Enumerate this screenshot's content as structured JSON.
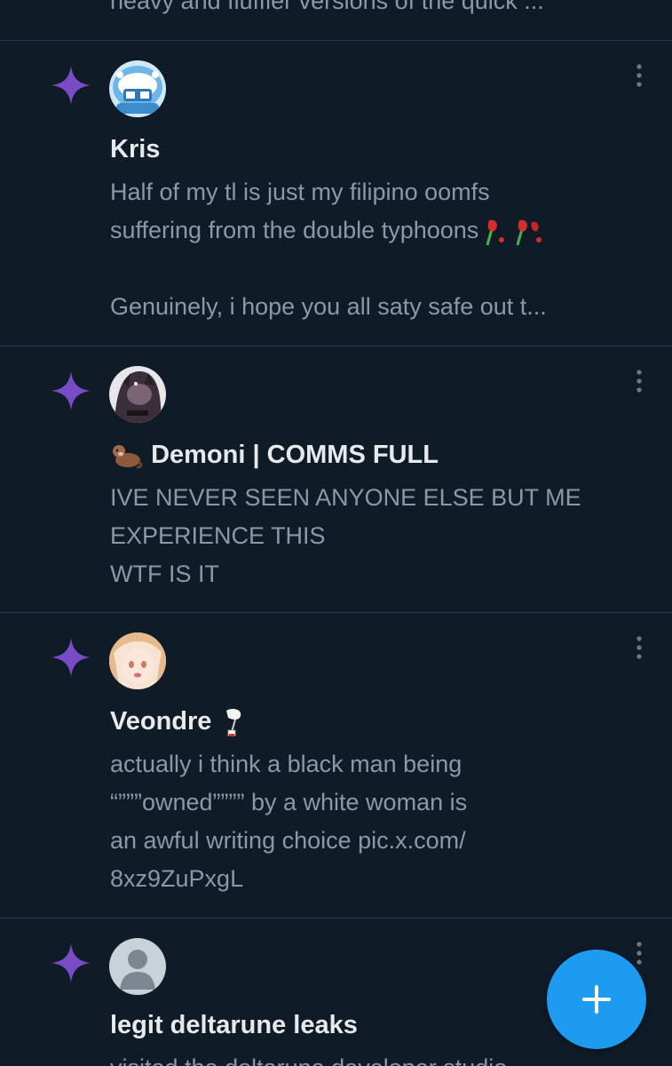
{
  "colors": {
    "background": "#0f1c28",
    "divider": "#2a3744",
    "sparkle": "#794bc4",
    "name_text": "#e7e9ea",
    "body_text": "#8b98a5",
    "fab": "#1d9bf0"
  },
  "prev_post": {
    "text_tail": "heavy and fluffier versions of the quick ..."
  },
  "posts": [
    {
      "name": "Kris",
      "lines": [
        "Half of my tl is just my filipino oomfs",
        "suffering from the double typhoons",
        "",
        "Genuinely, i hope you all saty safe out t..."
      ],
      "emoji": "wilted-flower-emoji x2"
    },
    {
      "name_prefix_emoji": "otter-emoji",
      "name": "Demoni | COMMS FULL",
      "lines": [
        "IVE NEVER SEEN ANYONE ELSE BUT ME",
        "EXPERIENCE THIS",
        "WTF IS IT"
      ]
    },
    {
      "name": "Veondre",
      "name_suffix_emoji": "wind-chime-emoji",
      "lines": [
        "actually i think a black man being",
        "“”””owned”””” by a white woman is",
        "an awful writing choice pic.x.com/",
        "8xz9ZuPxgL"
      ]
    },
    {
      "name": "legit deltarune leaks",
      "lines": [
        "visited the deltarune developer studio"
      ]
    }
  ],
  "icons": {
    "sparkle": "sparkle-icon",
    "more": "more-vertical-icon",
    "compose": "plus-icon"
  }
}
